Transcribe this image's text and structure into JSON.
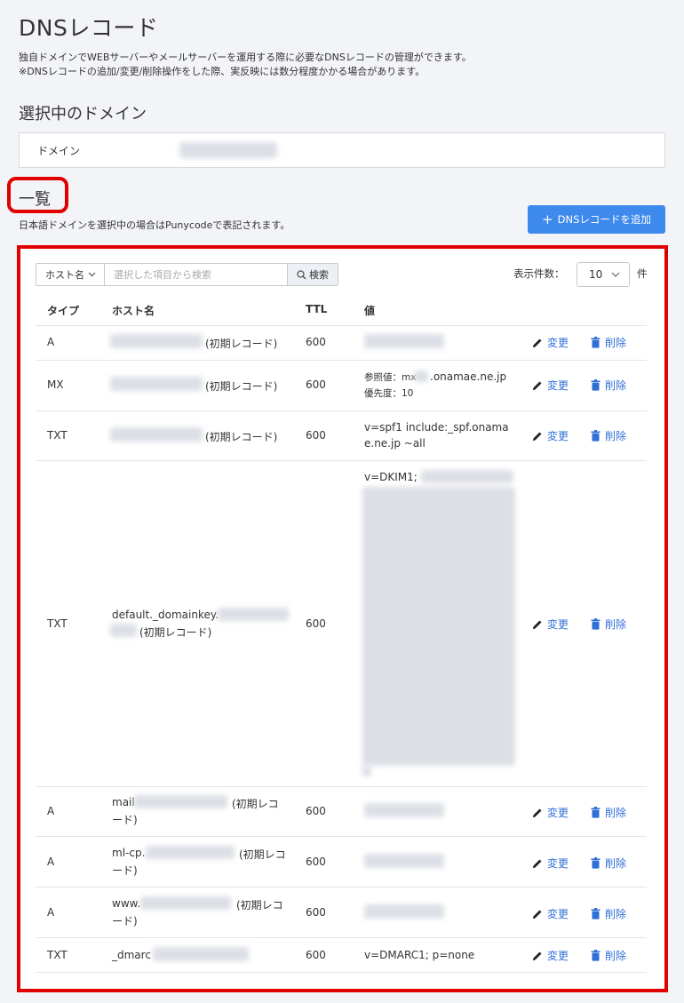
{
  "page": {
    "title": "DNSレコード",
    "description_line1": "独自ドメインでWEBサーバーやメールサーバーを運用する際に必要なDNSレコードの管理ができます。",
    "description_line2": "※DNSレコードの追加/変更/削除操作をした際、実反映には数分程度かかる場合があります。"
  },
  "selected_domain": {
    "heading": "選択中のドメイン",
    "label": "ドメイン"
  },
  "list": {
    "heading": "一覧",
    "note": "日本語ドメインを選択中の場合はPunycodeで表記されます。",
    "add_button": "DNSレコードを追加"
  },
  "search": {
    "select_value": "ホスト名",
    "placeholder": "選択した項目から検索",
    "button": "検索"
  },
  "pagination": {
    "label": "表示件数：",
    "value": "10",
    "unit": "件"
  },
  "table": {
    "headers": {
      "type": "タイプ",
      "host": "ホスト名",
      "ttl": "TTL",
      "value": "値"
    },
    "actions": {
      "edit": "変更",
      "delete": "削除"
    },
    "rows": [
      {
        "type": "A",
        "host_suffix": "(初期レコード)",
        "ttl": "600"
      },
      {
        "type": "MX",
        "host_suffix": "(初期レコード)",
        "ttl": "600",
        "value_ref": "参照値：mx",
        "value_ref_tail": ".onamae.ne.jp",
        "value_pri": "優先度：10"
      },
      {
        "type": "TXT",
        "host_suffix": "(初期レコード)",
        "ttl": "600",
        "value_line1": "v=spf1 include:_spf.onama",
        "value_line2": "e.ne.jp ~all"
      },
      {
        "type": "TXT",
        "host_prefix": "default._domainkey.",
        "host_suffix": "(初期レコード)",
        "ttl": "600",
        "value_line1": "v=DKIM1;"
      },
      {
        "type": "A",
        "host_prefix": "mail",
        "host_suffix": "(初期レコ",
        "host_suffix2": "ード)",
        "ttl": "600"
      },
      {
        "type": "A",
        "host_prefix": "ml-cp.",
        "host_suffix": "(初期レコ",
        "host_suffix2": "ード)",
        "ttl": "600"
      },
      {
        "type": "A",
        "host_prefix": "www.",
        "host_suffix": "(初期レコ",
        "host_suffix2": "ード)",
        "ttl": "600"
      },
      {
        "type": "TXT",
        "host_prefix": "_dmarc",
        "ttl": "600",
        "value_line1": "v=DMARC1; p=none"
      }
    ]
  }
}
